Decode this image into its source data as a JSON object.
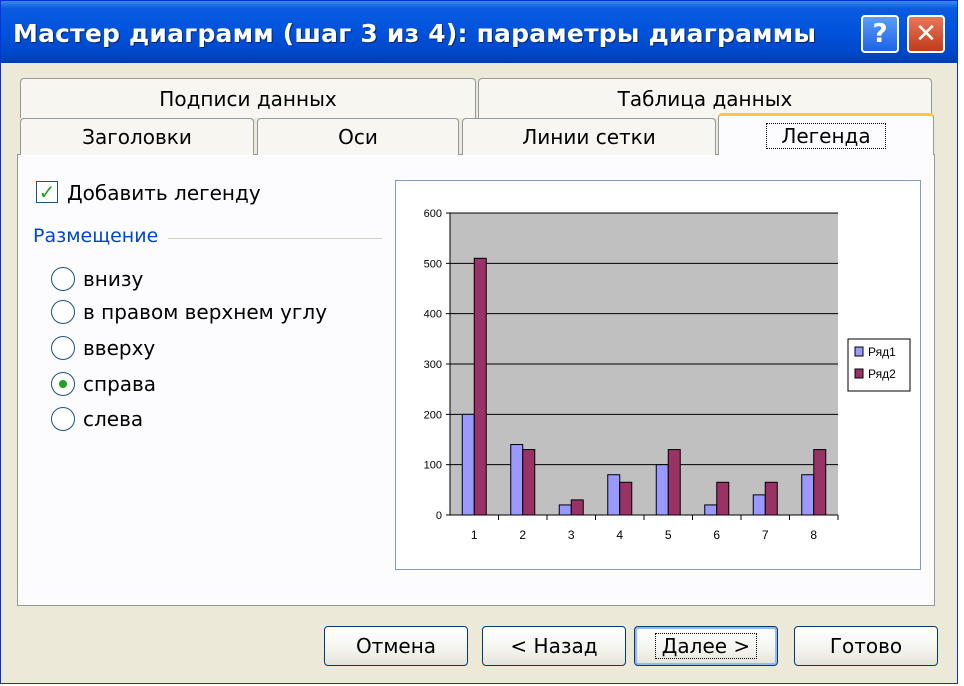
{
  "window": {
    "title": "Мастер диаграмм (шаг 3 из 4): параметры диаграммы",
    "help_label": "?",
    "close_label": "✕"
  },
  "tabs_back": [
    {
      "label": "Подписи данных"
    },
    {
      "label": "Таблица данных"
    }
  ],
  "tabs_front": [
    {
      "label": "Заголовки"
    },
    {
      "label": "Оси"
    },
    {
      "label": "Линии сетки"
    },
    {
      "label": "Легенда",
      "active": true
    }
  ],
  "legend_panel": {
    "show_legend_label": "Добавить легенду",
    "show_legend_checked": true,
    "placement_label": "Размещение",
    "options": [
      {
        "label": "внизу",
        "selected": false
      },
      {
        "label": "в правом верхнем углу",
        "selected": false
      },
      {
        "label": "вверху",
        "selected": false
      },
      {
        "label": "справа",
        "selected": true
      },
      {
        "label": "слева",
        "selected": false
      }
    ]
  },
  "buttons": {
    "cancel": "Отмена",
    "back": "< Назад",
    "next": "Далее >",
    "finish": "Готово"
  },
  "colors": {
    "series1": "#9999ff",
    "series2": "#993366",
    "plot_bg": "#c0c0c0"
  },
  "chart_data": {
    "type": "bar",
    "categories": [
      "1",
      "2",
      "3",
      "4",
      "5",
      "6",
      "7",
      "8"
    ],
    "series": [
      {
        "name": "Ряд1",
        "values": [
          200,
          140,
          20,
          80,
          100,
          20,
          40,
          80
        ]
      },
      {
        "name": "Ряд2",
        "values": [
          510,
          130,
          30,
          65,
          130,
          65,
          65,
          130
        ]
      }
    ],
    "ylim": [
      0,
      600
    ],
    "yticks": [
      0,
      100,
      200,
      300,
      400,
      500,
      600
    ],
    "grid": true,
    "legend": "right"
  }
}
